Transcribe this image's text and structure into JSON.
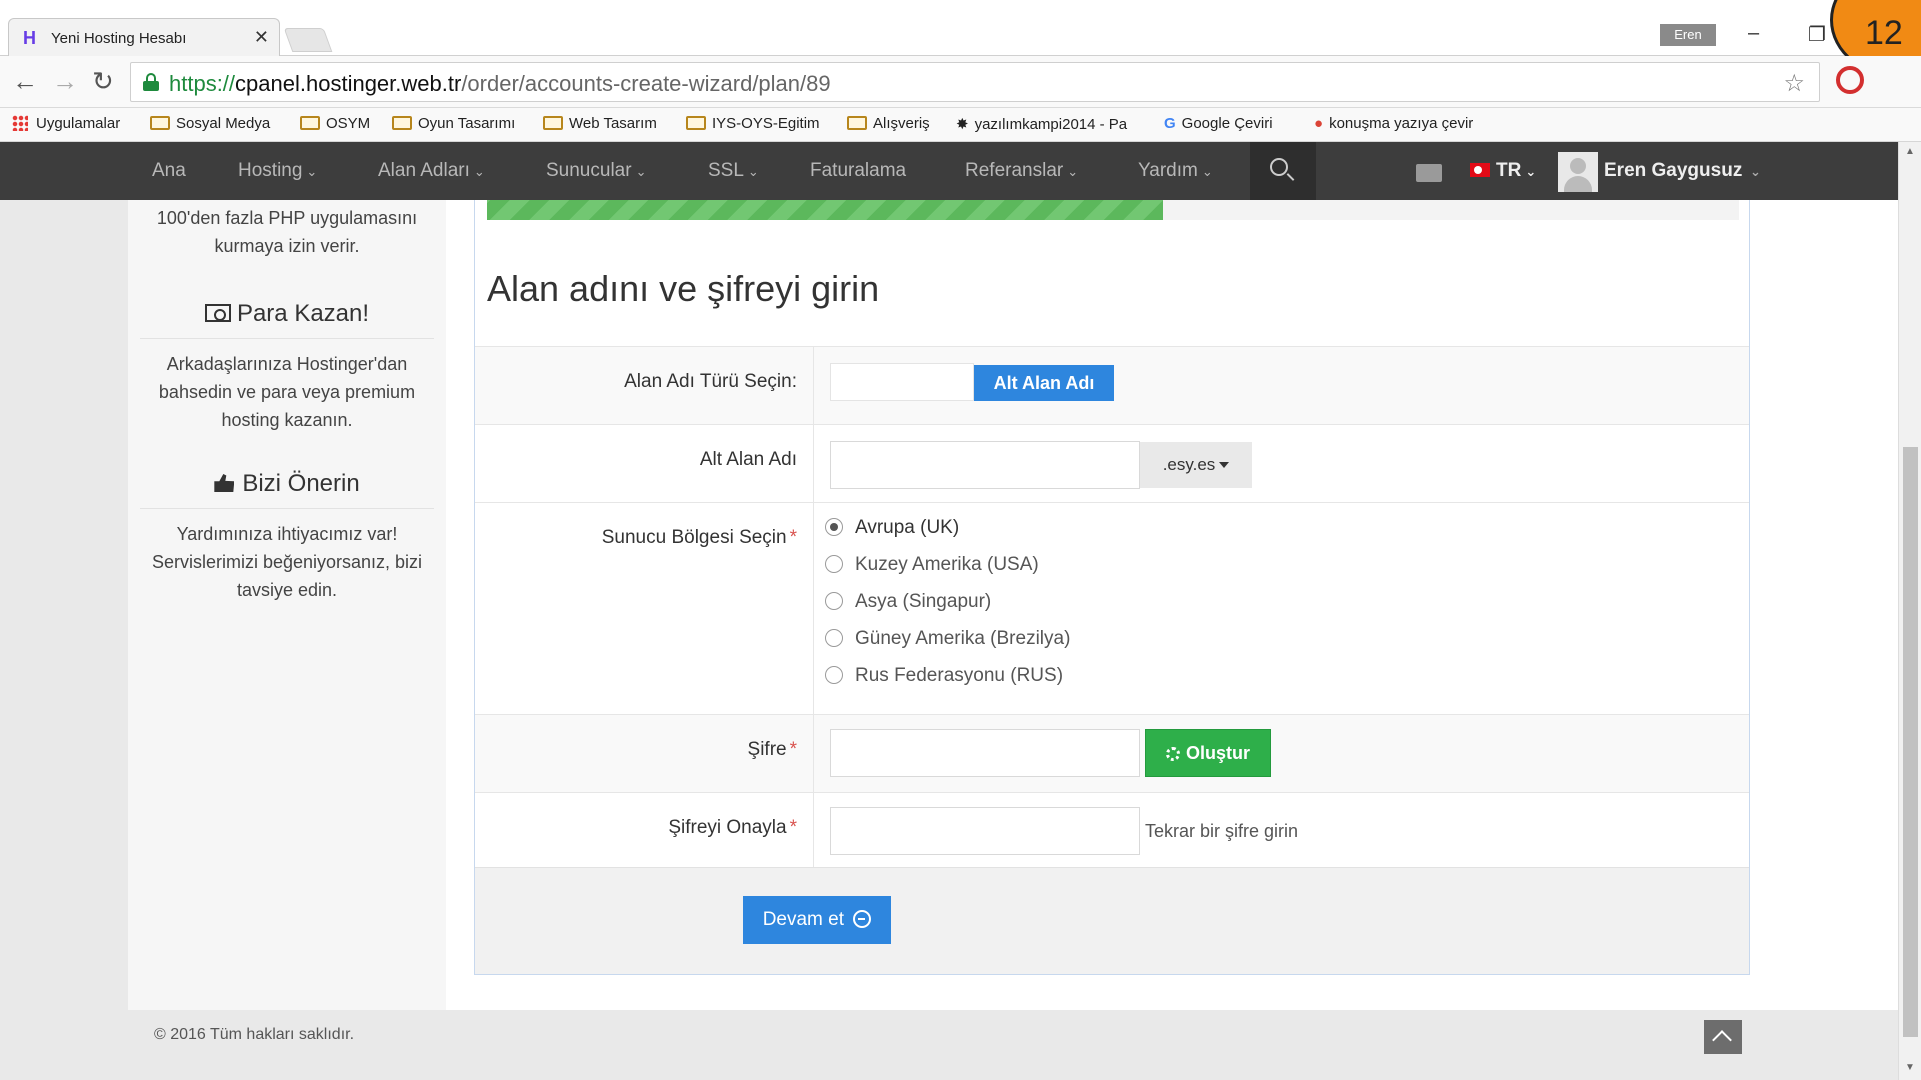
{
  "browser": {
    "tab_title": "Yeni Hosting Hesabı",
    "tab_close": "✕",
    "profile_name": "Eren",
    "url_scheme": "https://",
    "url_host": "cpanel.hostinger.web.tr",
    "url_path": "/order/accounts-create-wizard/plan/89",
    "bookmarks": [
      "Uygulamalar",
      "Sosyal Medya",
      "OSYM",
      "Oyun Tasarımı",
      "Web Tasarım",
      "IYS-OYS-Egitim",
      "Alışveriş",
      "yazılımkampi2014 - Pa",
      "Google Çeviri",
      "konuşma yazıya çevir"
    ]
  },
  "step_number": "12",
  "sitenav": {
    "items": [
      "Ana",
      "Hosting",
      "Alan Adları",
      "Sunucular",
      "SSL",
      "Faturalama",
      "Referanslar",
      "Yardım"
    ],
    "language": "TR",
    "user_name": "Eren Gaygusuz"
  },
  "sidebar": {
    "intro_text": "100'den fazla PHP uygulamasını kurmaya izin verir.",
    "earn_heading": "Para Kazan!",
    "earn_text": "Arkadaşlarınıza Hostinger'dan bahsedin ve para veya premium hosting kazanın.",
    "recommend_heading": "Bizi Önerin",
    "recommend_text": "Yardımınıza ihtiyacımız var! Servislerimizi beğeniyorsanız, bizi tavsiye edin."
  },
  "form": {
    "progress_fraction": 0.54,
    "title": "Alan adını ve şifreyi girin",
    "domain_type_label": "Alan Adı Türü Seçin:",
    "domain_type_button": "Alt Alan Adı",
    "subdomain_label": "Alt Alan Adı",
    "subdomain_value": "",
    "subdomain_suffix": ".esy.es",
    "region_label": "Sunucu Bölgesi Seçin",
    "regions": [
      "Avrupa (UK)",
      "Kuzey Amerika (USA)",
      "Asya (Singapur)",
      "Güney Amerika (Brezilya)",
      "Rus Federasyonu (RUS)"
    ],
    "selected_region": "Avrupa (UK)",
    "password_label": "Şifre",
    "password_value": "",
    "generate_button": "Oluştur",
    "confirm_label": "Şifreyi Onayla",
    "confirm_value": "",
    "confirm_hint": "Tekrar bir şifre girin",
    "required_mark": "*",
    "continue_button": "Devam et"
  },
  "footer": {
    "copyright": "© 2016 Tüm hakları saklıdır."
  }
}
